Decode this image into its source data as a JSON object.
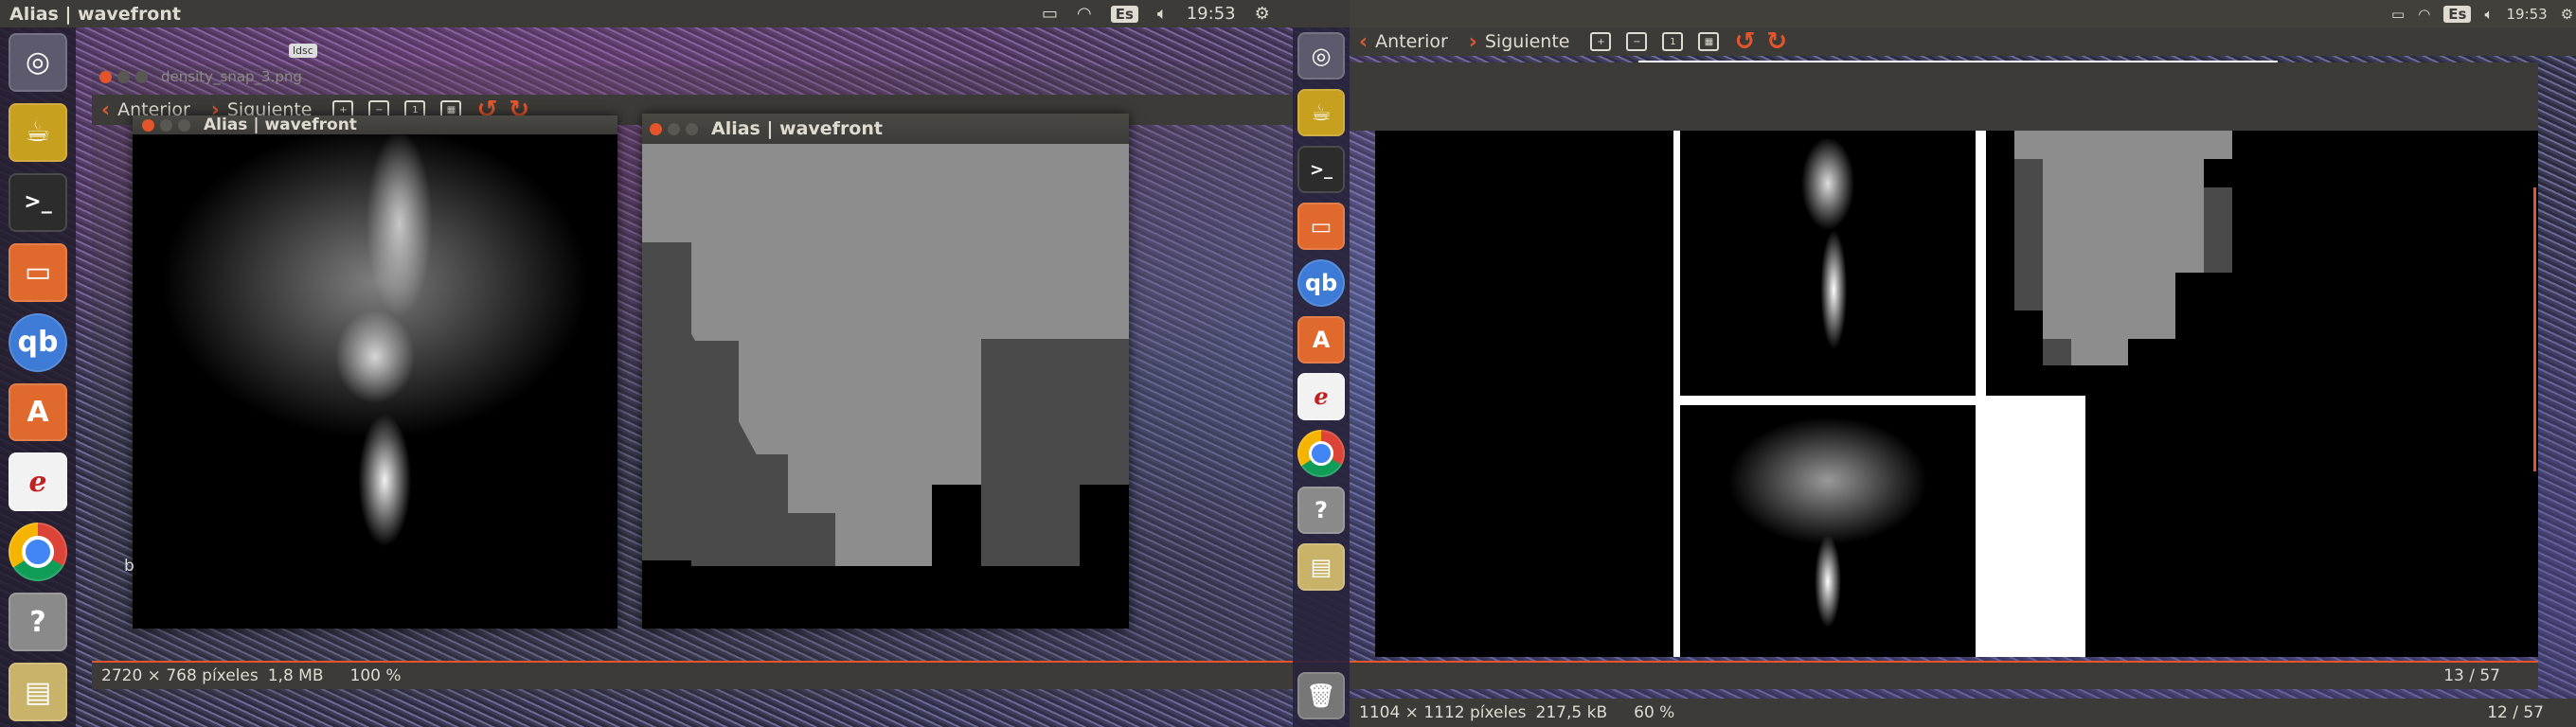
{
  "topbar": {
    "title": "Alias | wavefront",
    "keyboard": "Es",
    "time_left": "19:53",
    "time_right": "19:53"
  },
  "desktop": {
    "file_label": "ldsc",
    "side_letter": "b"
  },
  "viewer_left": {
    "filename": "density_snap_3.png",
    "prev_label": "Anterior",
    "next_label": "Siguiente",
    "status_dims": "2720 × 768 píxeles",
    "status_size": "1,8 MB",
    "status_zoom": "100 %",
    "status_page": "13 / 57"
  },
  "viewer_right": {
    "prev_label": "Anterior",
    "next_label": "Siguiente",
    "status_dims": "1104 × 1112 píxeles",
    "status_size": "217,5 kB",
    "status_zoom": "60 %",
    "status_page": "12 / 57"
  },
  "windows": {
    "smoke_title": "Alias | wavefront",
    "grid_title": "Alias | wavefront"
  },
  "launcher_icons": [
    "ubuntu-icon",
    "teapot-icon",
    "terminal-icon",
    "files-icon",
    "qbittorrent-icon",
    "software-center-icon",
    "emacs-icon",
    "chrome-icon",
    "help-icon",
    "monitor-icon"
  ],
  "colors": {
    "accent": "#e4552c",
    "panel": "#3c3b37",
    "text": "#dfdbd2"
  }
}
